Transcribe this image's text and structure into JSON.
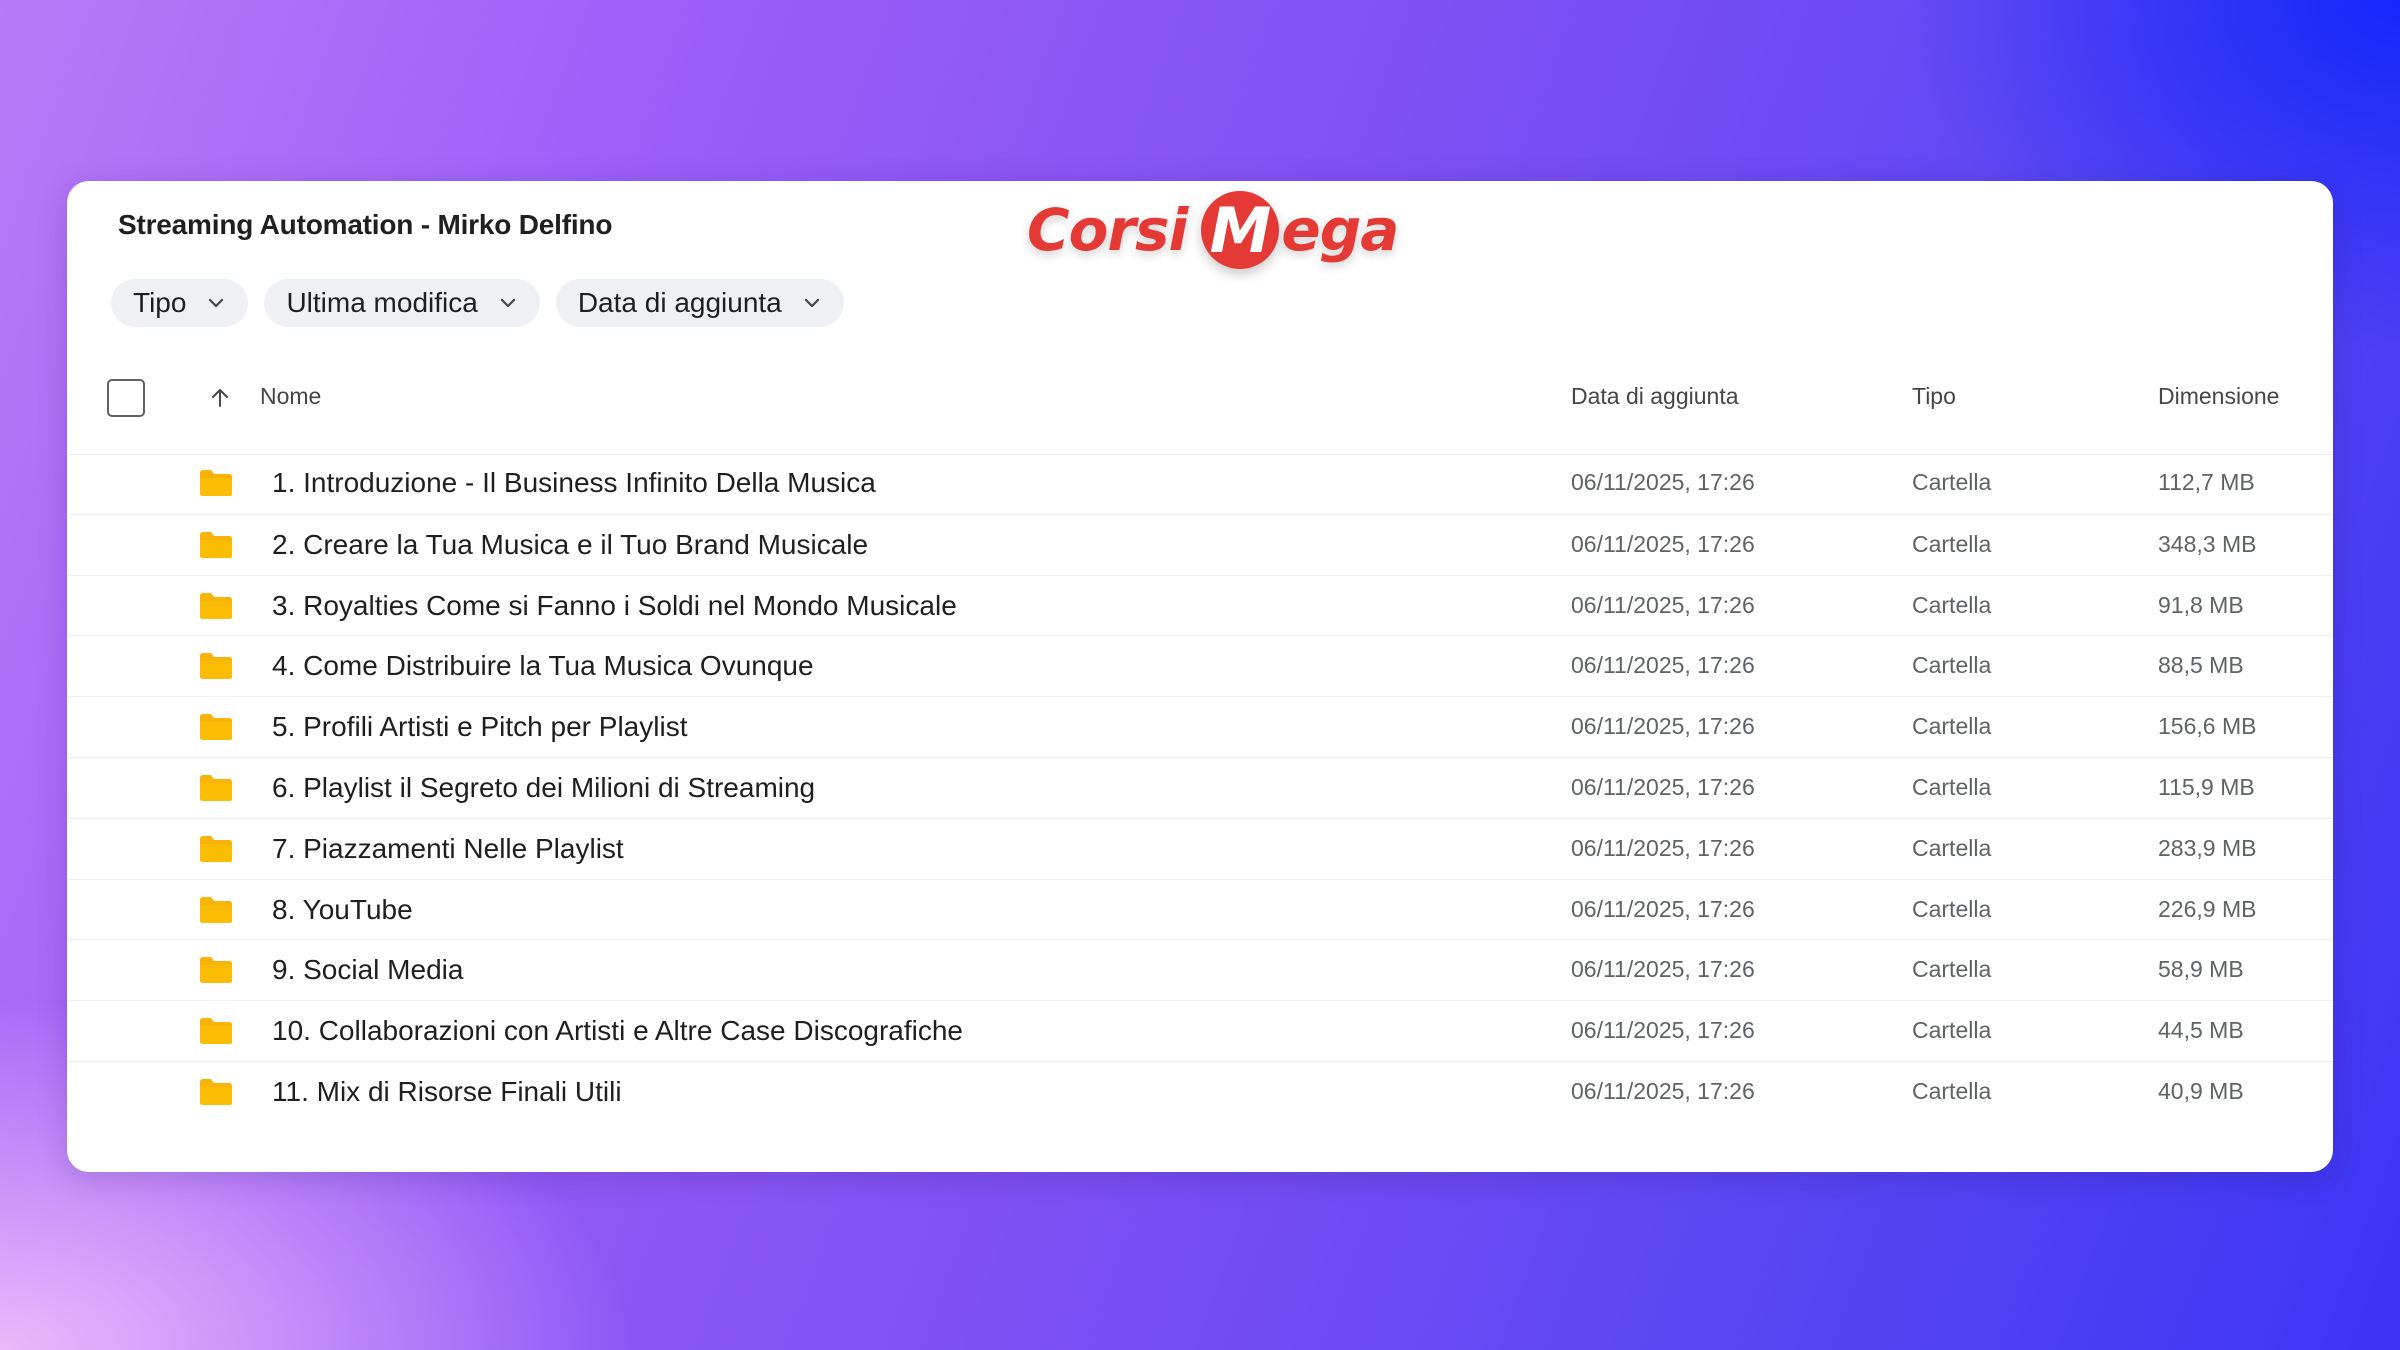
{
  "window": {
    "title": "Streaming Automation - Mirko Delfino"
  },
  "logo": {
    "word1": "Corsi",
    "badge_letter": "M",
    "word2": "ega",
    "color": "#e53935"
  },
  "filters": [
    {
      "label": "Tipo",
      "icon": "chevron-down-icon"
    },
    {
      "label": "Ultima modifica",
      "icon": "chevron-down-icon"
    },
    {
      "label": "Data di aggiunta",
      "icon": "chevron-down-icon"
    }
  ],
  "columns": {
    "name": "Nome",
    "date_added": "Data di aggiunta",
    "type": "Tipo",
    "size": "Dimensione",
    "sort_icon": "arrow-up-icon"
  },
  "rows": [
    {
      "name": "1. Introduzione - Il Business Infinito Della Musica",
      "date": "06/11/2025, 17:26",
      "type": "Cartella",
      "size": "112,7 MB"
    },
    {
      "name": "2. Creare la Tua Musica e il Tuo Brand Musicale",
      "date": "06/11/2025, 17:26",
      "type": "Cartella",
      "size": "348,3 MB"
    },
    {
      "name": "3. Royalties Come si Fanno i Soldi nel Mondo Musicale",
      "date": "06/11/2025, 17:26",
      "type": "Cartella",
      "size": "91,8 MB"
    },
    {
      "name": "4. Come Distribuire la Tua Musica Ovunque",
      "date": "06/11/2025, 17:26",
      "type": "Cartella",
      "size": "88,5 MB"
    },
    {
      "name": "5. Profili Artisti e Pitch per Playlist",
      "date": "06/11/2025, 17:26",
      "type": "Cartella",
      "size": "156,6 MB"
    },
    {
      "name": "6. Playlist il Segreto dei Milioni di Streaming",
      "date": "06/11/2025, 17:26",
      "type": "Cartella",
      "size": "115,9 MB"
    },
    {
      "name": "7. Piazzamenti Nelle Playlist",
      "date": "06/11/2025, 17:26",
      "type": "Cartella",
      "size": "283,9 MB"
    },
    {
      "name": "8. YouTube",
      "date": "06/11/2025, 17:26",
      "type": "Cartella",
      "size": "226,9 MB"
    },
    {
      "name": "9. Social Media",
      "date": "06/11/2025, 17:26",
      "type": "Cartella",
      "size": "58,9 MB"
    },
    {
      "name": "10. Collaborazioni con Artisti e Altre Case Discografiche",
      "date": "06/11/2025, 17:26",
      "type": "Cartella",
      "size": "44,5 MB"
    },
    {
      "name": "11. Mix di Risorse Finali Utili",
      "date": "06/11/2025, 17:26",
      "type": "Cartella",
      "size": "40,9 MB"
    }
  ],
  "colors": {
    "folder": "#f9b208",
    "text_primary": "#1f1f1f",
    "text_secondary": "#5f6368",
    "chip_bg": "#eef0f3"
  }
}
